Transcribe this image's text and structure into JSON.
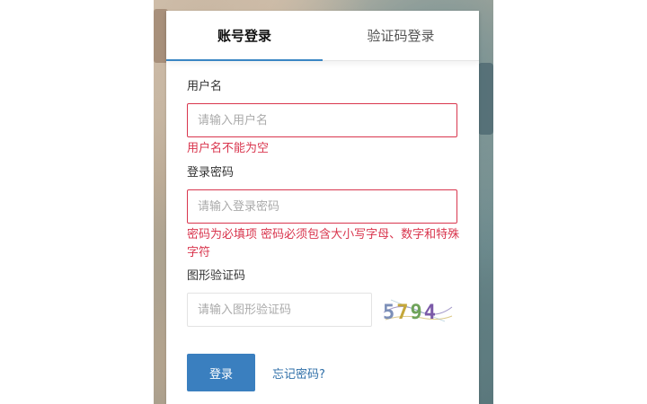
{
  "tabs": {
    "account_login": "账号登录",
    "sms_login": "验证码登录"
  },
  "username": {
    "label": "用户名",
    "placeholder": "请输入用户名",
    "value": "",
    "error": "用户名不能为空"
  },
  "password": {
    "label": "登录密码",
    "placeholder": "请输入登录密码",
    "value": "",
    "error": "密码为必填项 密码必须包含大小写字母、数字和特殊字符"
  },
  "captcha": {
    "label": "图形验证码",
    "placeholder": "请输入图形验证码",
    "value": "",
    "image_text": "5794"
  },
  "actions": {
    "login_label": "登录",
    "forgot_label": "忘记密码?"
  },
  "colors": {
    "accent": "#3a7fbf",
    "error": "#d9364e",
    "link": "#2f6fa8"
  }
}
